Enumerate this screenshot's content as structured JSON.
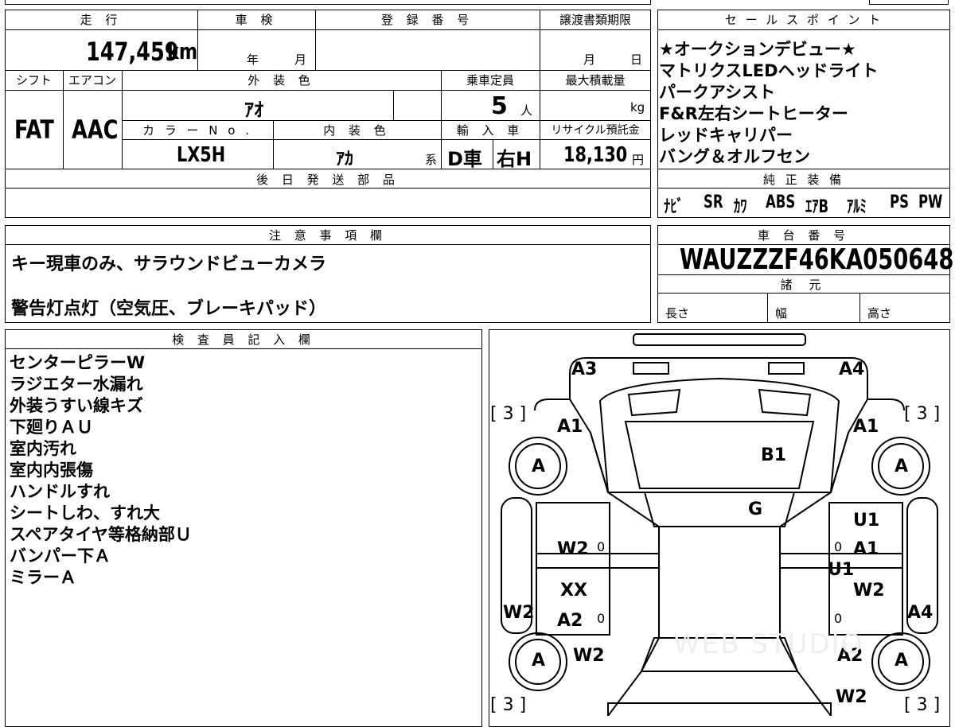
{
  "header": {
    "mileage_label": "走 行",
    "inspection_label": "車 検",
    "registration_label": "登 録 番 号",
    "transfer_deadline_label": "譲渡書類期限",
    "mileage_value": "147,459",
    "mileage_unit": "km",
    "year_label": "年",
    "month_label": "月",
    "deadline_month": "月",
    "deadline_day": "日"
  },
  "spec": {
    "shift_label": "シフト",
    "aircon_label": "エアコン",
    "exterior_color_label": "外 装 色",
    "capacity_label": "乗車定員",
    "max_load_label": "最大積載量",
    "shift_value": "FAT",
    "aircon_value": "AAC",
    "exterior_color_value": "ｱｵ",
    "capacity_value": "5",
    "capacity_unit": "人",
    "max_load_unit": "kg",
    "color_no_label": "カ ラ ー N o .",
    "interior_color_label": "内 装 色",
    "import_label": "輸 入 車",
    "recycle_label": "リサイクル預託金",
    "color_no_value": "LX5H",
    "interior_color_value": "ｱｶ",
    "interior_suffix": "系",
    "import_d": "D車",
    "import_h": "右H",
    "recycle_value": "18,130",
    "recycle_unit": "円",
    "later_parts_label": "後 日 発 送 部 品"
  },
  "sales_points": {
    "title": "セ ー ル ス ポ イ ン ト",
    "items": [
      "★オークションデビュー★",
      "マトリクスLEDヘッドライト",
      "パークアシスト",
      "F&R左右シートヒーター",
      "レッドキャリパー",
      "バング＆オルフセン"
    ]
  },
  "genuine_equipment": {
    "title": "純 正 装 備",
    "items": [
      "ﾅﾋﾞ",
      "SR",
      "ｶﾜ",
      "ABS",
      "ｴｱB",
      "ｱﾙﾐ",
      "PS",
      "PW"
    ]
  },
  "notes": {
    "title": "注 意 事 項 欄",
    "line1": "キー現車のみ、サラウンドビューカメラ",
    "line2": "警告灯点灯（空気圧、ブレーキパッド）"
  },
  "chassis": {
    "title": "車 台 番 号",
    "number": "WAUZZZF46KA050648",
    "specs_label": "諸 元",
    "length_label": "長さ",
    "width_label": "幅",
    "height_label": "高さ"
  },
  "inspector": {
    "title": "検 査 員 記 入 欄",
    "lines": [
      "センターピラーW",
      "ラジエター水漏れ",
      "外装うすい線キズ",
      "下廻りＡＵ",
      "室内汚れ",
      "室内内張傷",
      "ハンドルすれ",
      "シートしわ、すれ大",
      "スペアタイヤ等格納部Ｕ",
      "バンパー下Ａ",
      "ミラーＡ"
    ]
  },
  "diagram": {
    "a3": "A3",
    "a4_top": "A4",
    "a1_left": "A1",
    "a1_right": "A1",
    "b1": "B1",
    "g": "G",
    "u1": "U1",
    "a1_mid": "A1",
    "u1_low": "U1",
    "w2_right": "W2",
    "a4_right": "A4",
    "w2_left_mid": "W2",
    "xx": "XX",
    "a2_left": "A2",
    "w2_left": "W2",
    "w2_left_bottom": "W2",
    "a2_right": "A2",
    "w2_right_bottom": "W2",
    "tire_a": "A",
    "bracket3": "[ 3 ]",
    "zero": "0",
    "watermark": "WEB STUDIO"
  }
}
